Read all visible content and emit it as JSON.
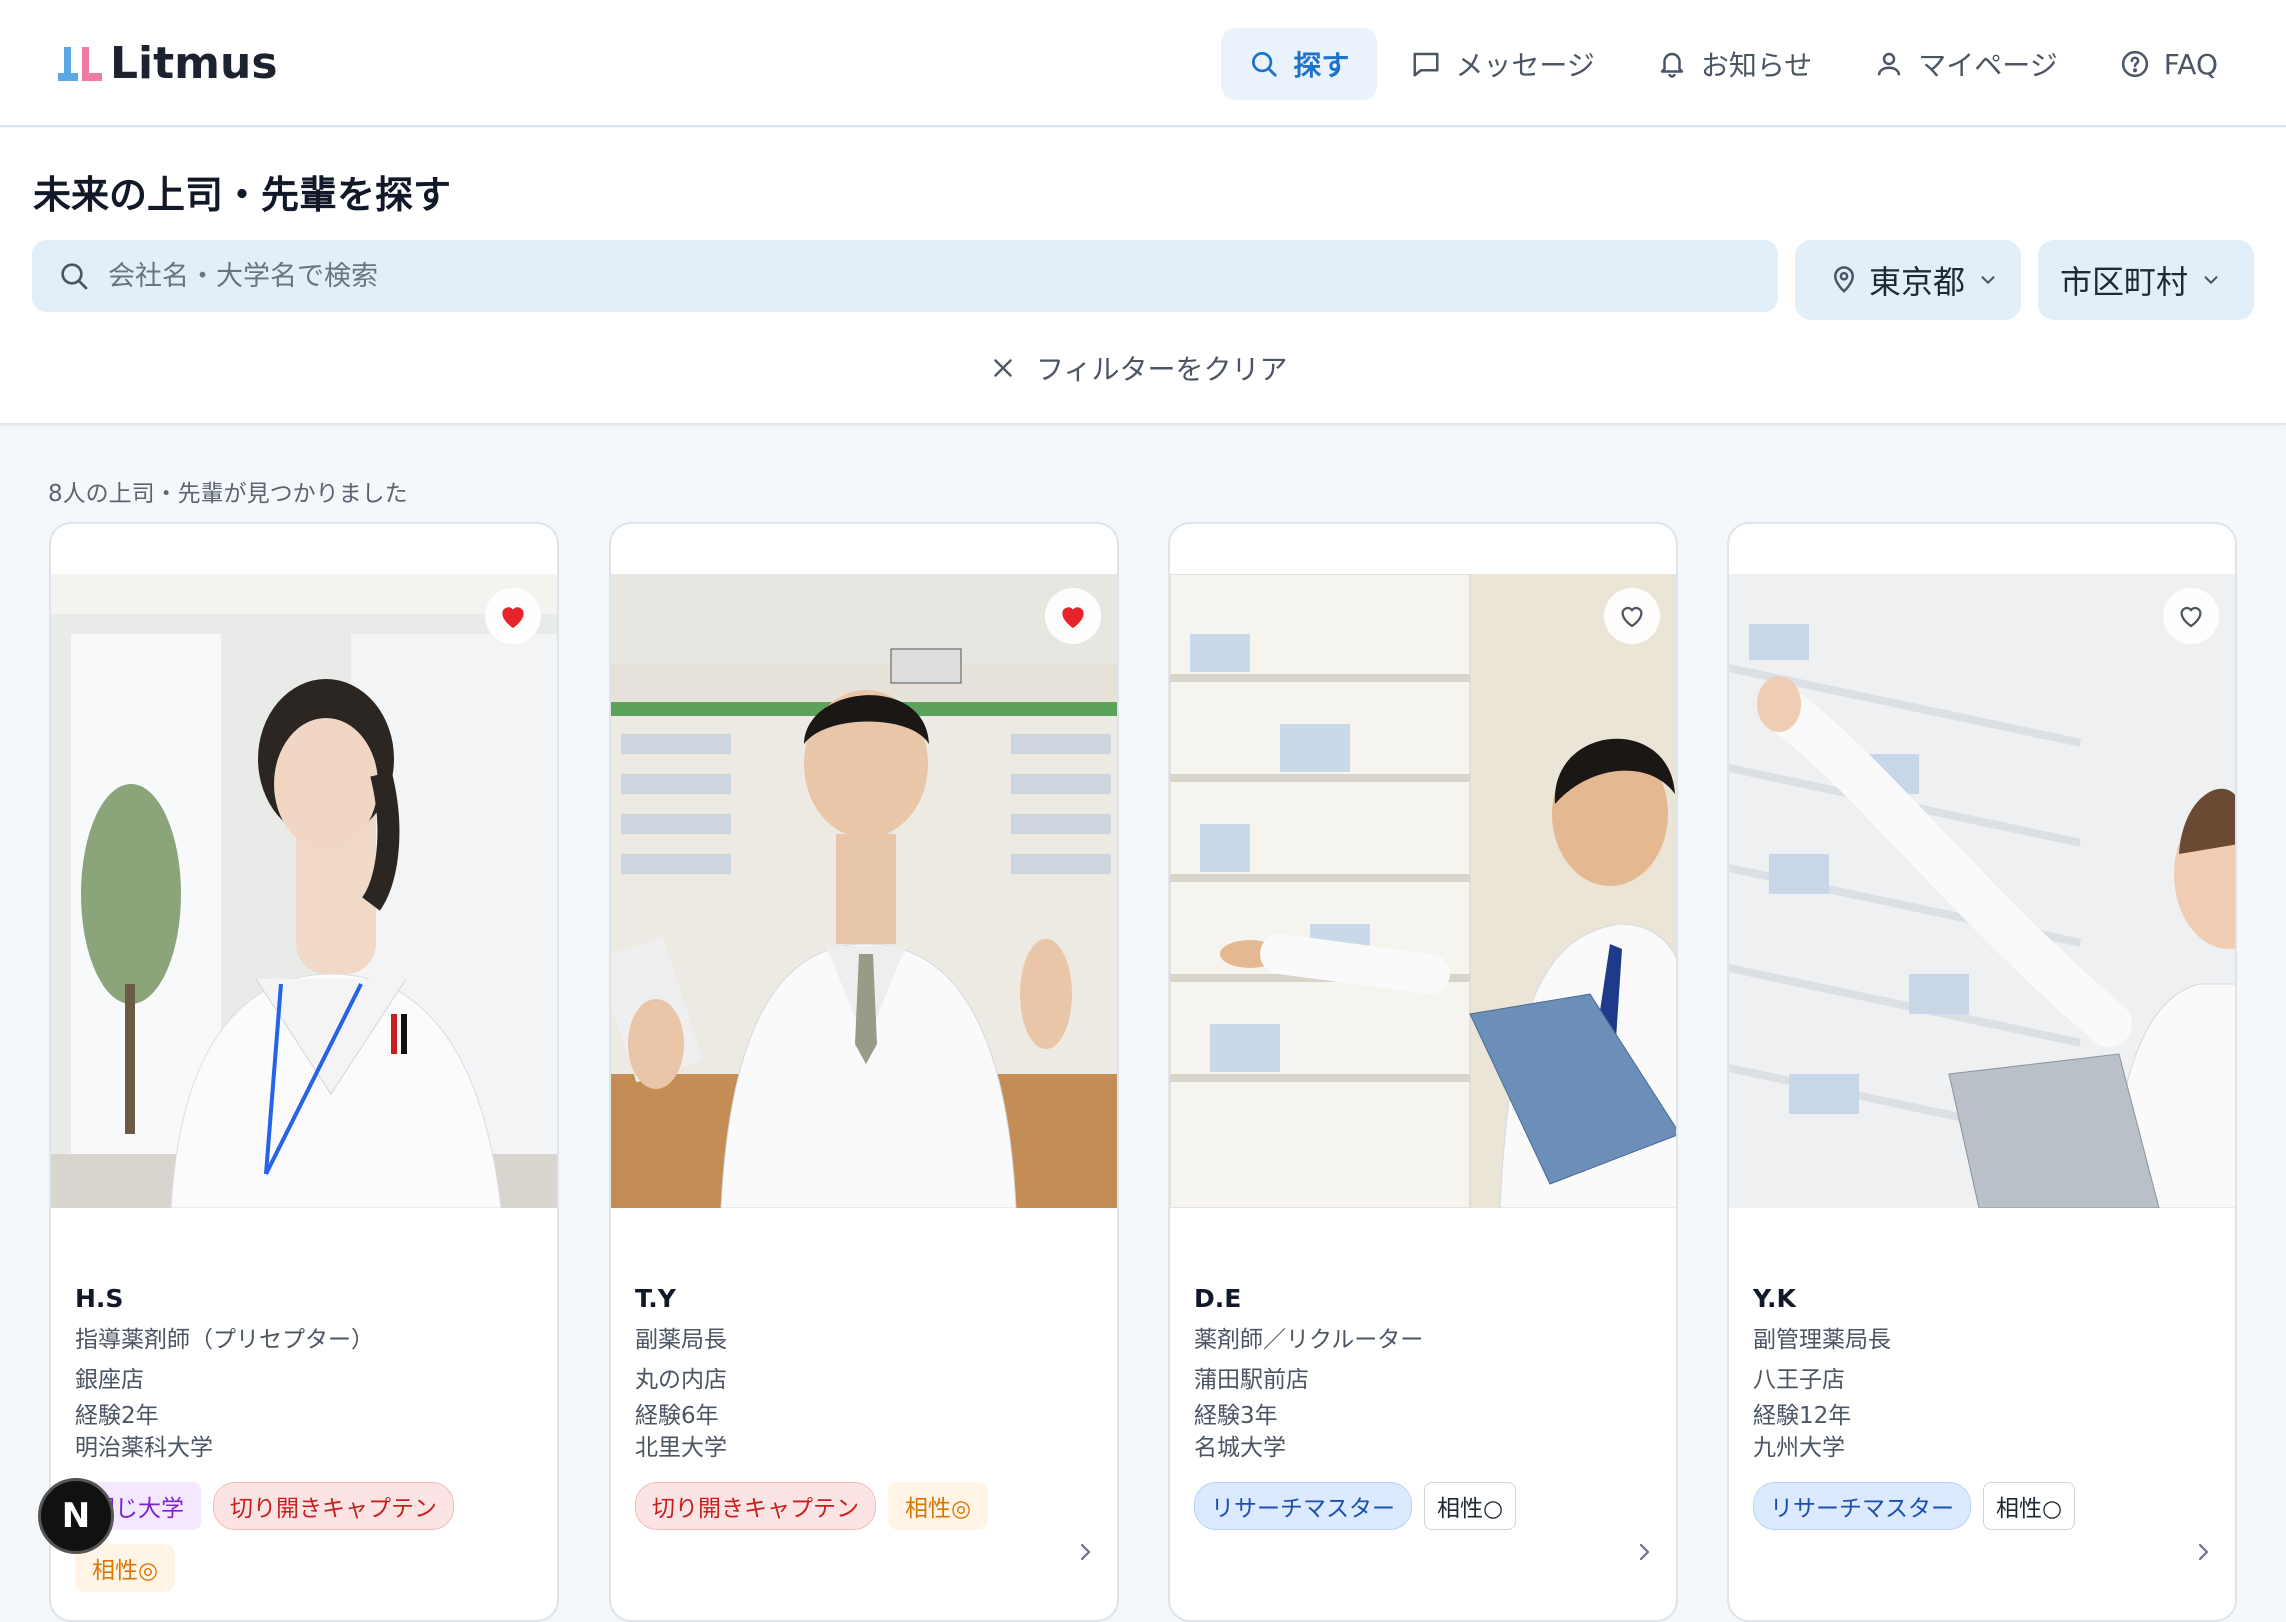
{
  "app": {
    "name": "Litmus"
  },
  "nav": [
    {
      "label": "探す",
      "icon": "search-icon",
      "active": true
    },
    {
      "label": "メッセージ",
      "icon": "message-icon",
      "active": false
    },
    {
      "label": "お知らせ",
      "icon": "bell-icon",
      "active": false
    },
    {
      "label": "マイページ",
      "icon": "user-icon",
      "active": false
    },
    {
      "label": "FAQ",
      "icon": "help-icon",
      "active": false
    }
  ],
  "search_panel": {
    "title": "未来の上司・先輩を探す",
    "search_placeholder": "会社名・大学名で検索",
    "prefecture": "東京都",
    "city": "市区町村",
    "clear_label": "フィルターをクリア"
  },
  "results": {
    "count_text": "8人の上司・先輩が見つかりました",
    "cards": [
      {
        "name": "H.S",
        "role": "指導薬剤師（プリセプター）",
        "store": "銀座店",
        "experience": "経験2年",
        "university": "明治薬科大学",
        "favorited": true,
        "tags": [
          "同じ大学",
          "切り開きキャプテン",
          "相性◎"
        ]
      },
      {
        "name": "T.Y",
        "role": "副薬局長",
        "store": "丸の内店",
        "experience": "経験6年",
        "university": "北里大学",
        "favorited": true,
        "tags": [
          "切り開きキャプテン",
          "相性◎"
        ]
      },
      {
        "name": "D.E",
        "role": "薬剤師／リクルーター",
        "store": "蒲田駅前店",
        "experience": "経験3年",
        "university": "名城大学",
        "favorited": false,
        "tags": [
          "リサーチマスター",
          "相性○"
        ]
      },
      {
        "name": "Y.K",
        "role": "副管理薬局長",
        "store": "八王子店",
        "experience": "経験12年",
        "university": "九州大学",
        "favorited": false,
        "tags": [
          "リサーチマスター",
          "相性○"
        ]
      }
    ]
  },
  "floating_badge": "N",
  "colors": {
    "accent": "#1d73c9",
    "heart": "#e5242b",
    "header_border": "#d7e6f1"
  }
}
